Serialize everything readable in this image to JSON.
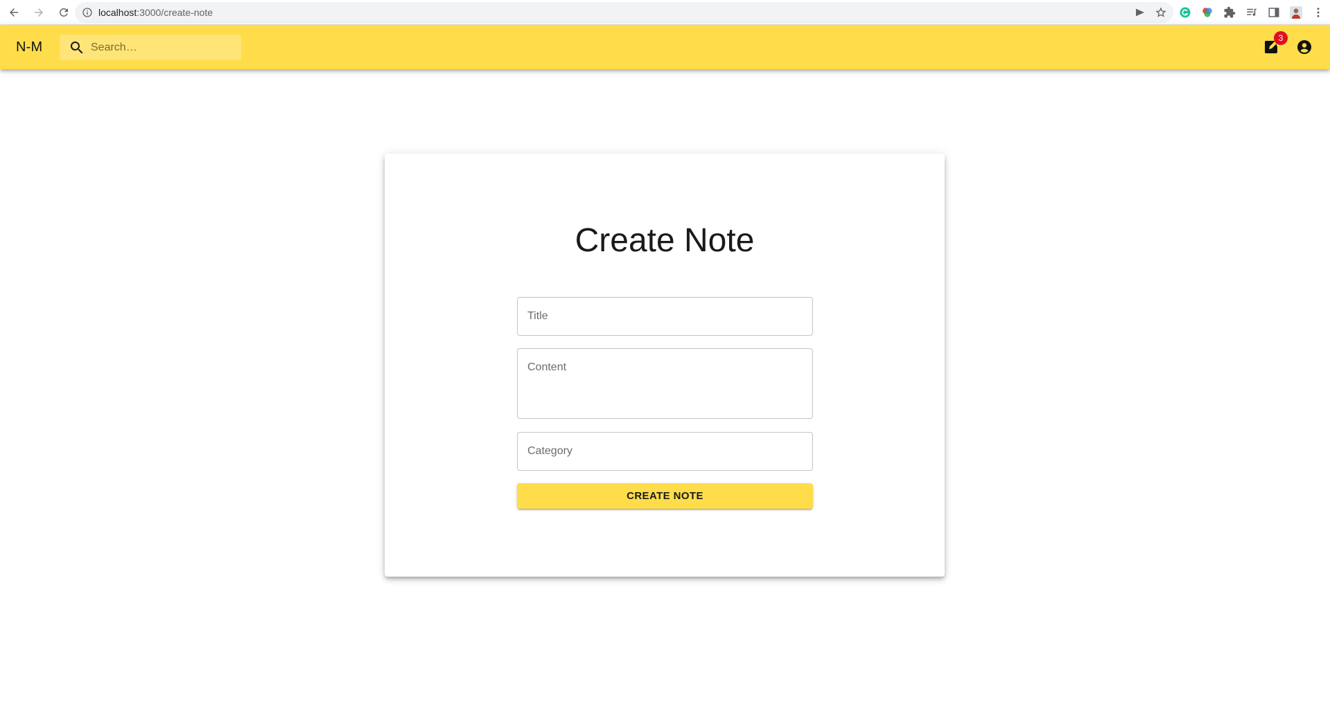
{
  "browser": {
    "url_host": "localhost",
    "url_path": ":3000/create-note"
  },
  "app_bar": {
    "brand": "N-M",
    "search_placeholder": "Search…",
    "notes_badge": "3",
    "accent_color": "#ffdd4a",
    "badge_color": "#e01020"
  },
  "form": {
    "title": "Create Note",
    "title_placeholder": "Title",
    "content_placeholder": "Content",
    "category_placeholder": "Category",
    "submit_label": "CREATE NOTE"
  },
  "icons": {
    "back": "arrow-left-icon",
    "forward": "arrow-right-icon",
    "reload": "reload-icon",
    "site_info": "info-icon",
    "send": "send-icon",
    "bookmark": "star-icon",
    "search": "search-icon",
    "notes": "edit-note-icon",
    "account": "account-circle-icon"
  }
}
